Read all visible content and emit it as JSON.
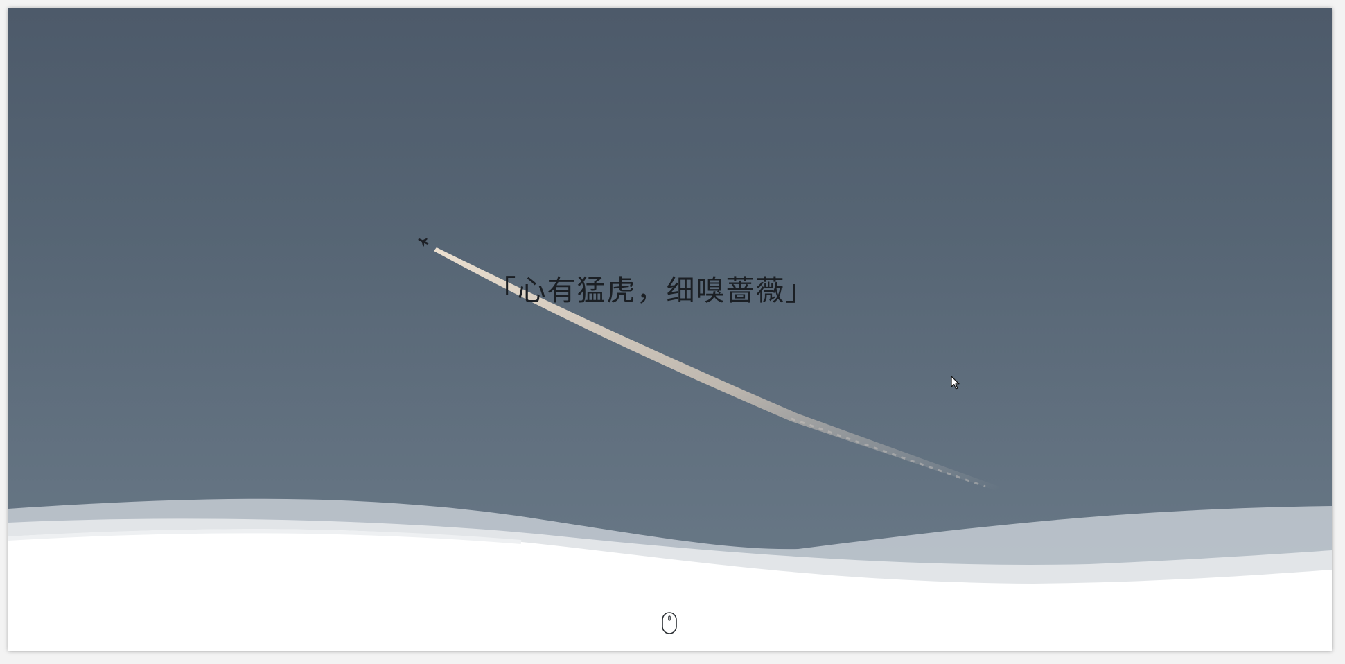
{
  "hero": {
    "quote": "「心有猛虎，细嗅蔷薇」"
  },
  "colors": {
    "sky_top": "#4d5a6a",
    "sky_bottom": "#6c7c8a",
    "wave_light": "#d9dee3",
    "wave_mid": "#b5bec7",
    "page_background": "#ffffff",
    "quote_text": "#1b1f24"
  },
  "icons": {
    "scroll_indicator": "mouse-scroll-icon",
    "cursor": "arrow-cursor-icon"
  }
}
